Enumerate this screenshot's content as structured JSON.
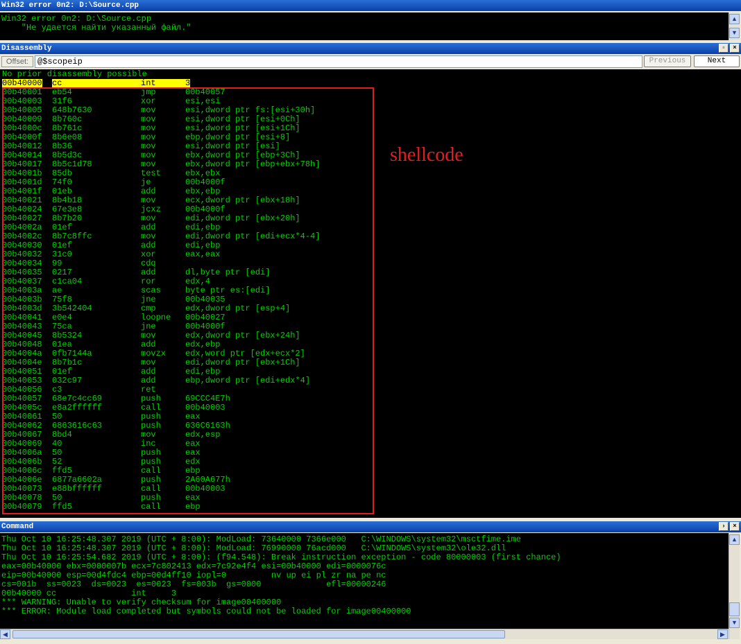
{
  "error_window": {
    "title": "Win32 error 0n2: D:\\Source.cpp",
    "lines": [
      "Win32 error 0n2: D:\\Source.cpp",
      "    \"Не удается найти указанный файл.\""
    ]
  },
  "disassembly": {
    "title": "Disassembly",
    "offset_label": "Offset:",
    "offset_value": "@$scopeip",
    "previous_label": "Previous",
    "next_label": "Next",
    "header_line": "No prior disassembly possible",
    "current": {
      "addr": "00b40000",
      "hex": "cc",
      "mnemonic": "int",
      "operands": "3"
    },
    "annotation": "shellcode",
    "rows": [
      {
        "addr": "00b40001",
        "hex": "eb54",
        "mnemonic": "jmp",
        "operands": "00b40057"
      },
      {
        "addr": "00b40003",
        "hex": "31f6",
        "mnemonic": "xor",
        "operands": "esi,esi"
      },
      {
        "addr": "00b40005",
        "hex": "648b7630",
        "mnemonic": "mov",
        "operands": "esi,dword ptr fs:[esi+30h]"
      },
      {
        "addr": "00b40009",
        "hex": "8b760c",
        "mnemonic": "mov",
        "operands": "esi,dword ptr [esi+0Ch]"
      },
      {
        "addr": "00b4000c",
        "hex": "8b761c",
        "mnemonic": "mov",
        "operands": "esi,dword ptr [esi+1Ch]"
      },
      {
        "addr": "00b4000f",
        "hex": "8b6e08",
        "mnemonic": "mov",
        "operands": "ebp,dword ptr [esi+8]"
      },
      {
        "addr": "00b40012",
        "hex": "8b36",
        "mnemonic": "mov",
        "operands": "esi,dword ptr [esi]"
      },
      {
        "addr": "00b40014",
        "hex": "8b5d3c",
        "mnemonic": "mov",
        "operands": "ebx,dword ptr [ebp+3Ch]"
      },
      {
        "addr": "00b40017",
        "hex": "8b5c1d78",
        "mnemonic": "mov",
        "operands": "ebx,dword ptr [ebp+ebx+78h]"
      },
      {
        "addr": "00b4001b",
        "hex": "85db",
        "mnemonic": "test",
        "operands": "ebx,ebx"
      },
      {
        "addr": "00b4001d",
        "hex": "74f0",
        "mnemonic": "je",
        "operands": "00b4000f"
      },
      {
        "addr": "00b4001f",
        "hex": "01eb",
        "mnemonic": "add",
        "operands": "ebx,ebp"
      },
      {
        "addr": "00b40021",
        "hex": "8b4b18",
        "mnemonic": "mov",
        "operands": "ecx,dword ptr [ebx+18h]"
      },
      {
        "addr": "00b40024",
        "hex": "67e3e8",
        "mnemonic": "jcxz",
        "operands": "00b4000f"
      },
      {
        "addr": "00b40027",
        "hex": "8b7b20",
        "mnemonic": "mov",
        "operands": "edi,dword ptr [ebx+20h]"
      },
      {
        "addr": "00b4002a",
        "hex": "01ef",
        "mnemonic": "add",
        "operands": "edi,ebp"
      },
      {
        "addr": "00b4002c",
        "hex": "8b7c8ffc",
        "mnemonic": "mov",
        "operands": "edi,dword ptr [edi+ecx*4-4]"
      },
      {
        "addr": "00b40030",
        "hex": "01ef",
        "mnemonic": "add",
        "operands": "edi,ebp"
      },
      {
        "addr": "00b40032",
        "hex": "31c0",
        "mnemonic": "xor",
        "operands": "eax,eax"
      },
      {
        "addr": "00b40034",
        "hex": "99",
        "mnemonic": "cdq",
        "operands": ""
      },
      {
        "addr": "00b40035",
        "hex": "0217",
        "mnemonic": "add",
        "operands": "dl,byte ptr [edi]"
      },
      {
        "addr": "00b40037",
        "hex": "c1ca04",
        "mnemonic": "ror",
        "operands": "edx,4"
      },
      {
        "addr": "00b4003a",
        "hex": "ae",
        "mnemonic": "scas",
        "operands": "byte ptr es:[edi]"
      },
      {
        "addr": "00b4003b",
        "hex": "75f8",
        "mnemonic": "jne",
        "operands": "00b40035"
      },
      {
        "addr": "00b4003d",
        "hex": "3b542404",
        "mnemonic": "cmp",
        "operands": "edx,dword ptr [esp+4]"
      },
      {
        "addr": "00b40041",
        "hex": "e0e4",
        "mnemonic": "loopne",
        "operands": "00b40027"
      },
      {
        "addr": "00b40043",
        "hex": "75ca",
        "mnemonic": "jne",
        "operands": "00b4000f"
      },
      {
        "addr": "00b40045",
        "hex": "8b5324",
        "mnemonic": "mov",
        "operands": "edx,dword ptr [ebx+24h]"
      },
      {
        "addr": "00b40048",
        "hex": "01ea",
        "mnemonic": "add",
        "operands": "edx,ebp"
      },
      {
        "addr": "00b4004a",
        "hex": "0fb7144a",
        "mnemonic": "movzx",
        "operands": "edx,word ptr [edx+ecx*2]"
      },
      {
        "addr": "00b4004e",
        "hex": "8b7b1c",
        "mnemonic": "mov",
        "operands": "edi,dword ptr [ebx+1Ch]"
      },
      {
        "addr": "00b40051",
        "hex": "01ef",
        "mnemonic": "add",
        "operands": "edi,ebp"
      },
      {
        "addr": "00b40053",
        "hex": "032c97",
        "mnemonic": "add",
        "operands": "ebp,dword ptr [edi+edx*4]"
      },
      {
        "addr": "00b40056",
        "hex": "c3",
        "mnemonic": "ret",
        "operands": ""
      },
      {
        "addr": "00b40057",
        "hex": "68e7c4cc69",
        "mnemonic": "push",
        "operands": "69CCC4E7h"
      },
      {
        "addr": "00b4005c",
        "hex": "e8a2ffffff",
        "mnemonic": "call",
        "operands": "00b40003"
      },
      {
        "addr": "00b40061",
        "hex": "50",
        "mnemonic": "push",
        "operands": "eax"
      },
      {
        "addr": "00b40062",
        "hex": "6863616c63",
        "mnemonic": "push",
        "operands": "636C6163h"
      },
      {
        "addr": "00b40067",
        "hex": "8bd4",
        "mnemonic": "mov",
        "operands": "edx,esp"
      },
      {
        "addr": "00b40069",
        "hex": "40",
        "mnemonic": "inc",
        "operands": "eax"
      },
      {
        "addr": "00b4006a",
        "hex": "50",
        "mnemonic": "push",
        "operands": "eax"
      },
      {
        "addr": "00b4006b",
        "hex": "52",
        "mnemonic": "push",
        "operands": "edx"
      },
      {
        "addr": "00b4006c",
        "hex": "ffd5",
        "mnemonic": "call",
        "operands": "ebp"
      },
      {
        "addr": "00b4006e",
        "hex": "6877a6602a",
        "mnemonic": "push",
        "operands": "2A60A677h"
      },
      {
        "addr": "00b40073",
        "hex": "e88bffffff",
        "mnemonic": "call",
        "operands": "00b40003"
      },
      {
        "addr": "00b40078",
        "hex": "50",
        "mnemonic": "push",
        "operands": "eax"
      },
      {
        "addr": "00b40079",
        "hex": "ffd5",
        "mnemonic": "call",
        "operands": "ebp"
      }
    ]
  },
  "command": {
    "title": "Command",
    "lines": [
      {
        "text": "Thu Oct 10 16:25:48.307 2019 (UTC + 8:00): ModLoad: 73640000 7366e000   C:\\WINDOWS\\system32\\msctfime.ime",
        "color": "#00d000"
      },
      {
        "text": "Thu Oct 10 16:25:48.307 2019 (UTC + 8:00): ModLoad: 76990000 76acd000   C:\\WINDOWS\\system32\\ole32.dll",
        "color": "#00d000"
      },
      {
        "text": "Thu Oct 10 16:25:54.682 2019 (UTC + 8:00): (f94.548): Break instruction exception - code 80000003 (first chance)",
        "color": "#00d000"
      },
      {
        "text": "eax=00b40000 ebx=0000007b ecx=7c802413 edx=7c92e4f4 esi=00b40000 edi=0000076c",
        "color": "#00d000"
      },
      {
        "text": "eip=00b40000 esp=00d4fdc4 ebp=00d4ff10 iopl=0         nv up ei pl zr na pe nc",
        "color": "#00d000"
      },
      {
        "text": "cs=001b  ss=0023  ds=0023  es=0023  fs=003b  gs=0000             efl=00000246",
        "color": "#00d000"
      },
      {
        "text": "00b40000 cc               int     3",
        "color": "#00d000"
      },
      {
        "text": "*** WARNING: Unable to verify checksum for image00400000",
        "color": "#00d000"
      },
      {
        "text": "*** ERROR: Module load completed but symbols could not be loaded for image00400000",
        "color": "#00d000"
      }
    ]
  },
  "colors": {
    "text_green": "#00d000",
    "highlight": "#ffff00",
    "annotation_red": "#e02020",
    "titlebar_blue": "#0a3fa8"
  }
}
